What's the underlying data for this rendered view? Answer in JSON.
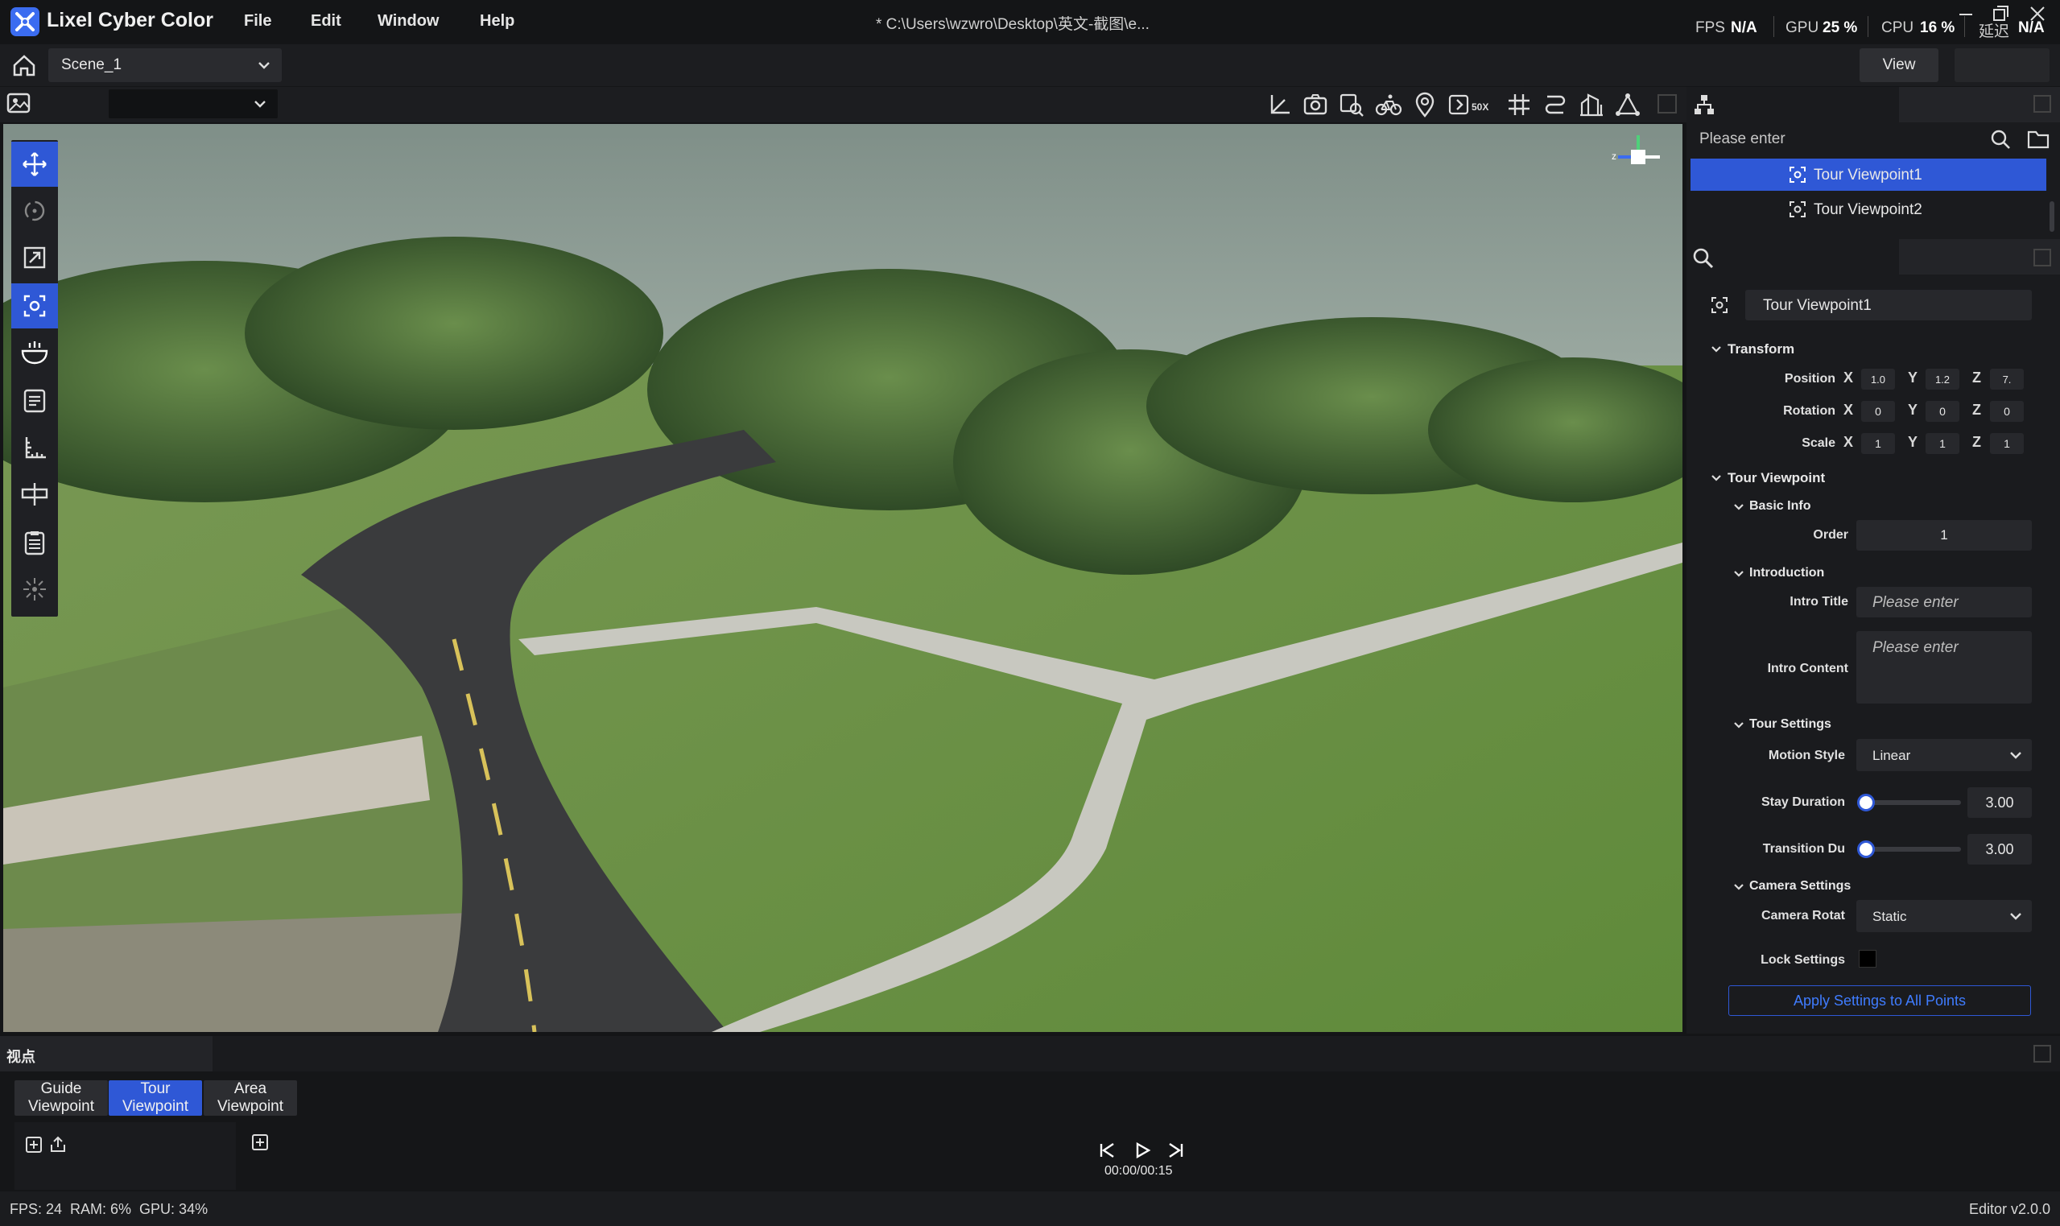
{
  "app": {
    "name": "Lixel Cyber Color",
    "menu": [
      "File",
      "Edit",
      "Window",
      "Help"
    ],
    "file_path": "* C:\\Users\\wzwro\\Desktop\\英文-截图\\e...",
    "stats": {
      "fps_label": "FPS",
      "fps_value": "N/A",
      "gpu_label": "GPU",
      "gpu_value": "25 %",
      "cpu_label": "CPU",
      "cpu_value": "16 %",
      "latency_label": "延迟",
      "latency_value": "N/A"
    }
  },
  "toolbar": {
    "scene": "Scene_1",
    "view_button": "View",
    "icons": [
      "coordinate-icon",
      "camera-icon",
      "search-viewpoint-icon",
      "bike-icon",
      "location-pin-icon",
      "speed-50x-icon",
      "grid-icon",
      "route-icon",
      "building-icon",
      "vertex-icon"
    ],
    "speed_label": "50X"
  },
  "left_tools": [
    "move-icon",
    "rotate-icon",
    "scale-icon",
    "viewpoint-icon",
    "bowl-icon",
    "notes-icon",
    "measure-icon",
    "signpost-icon",
    "clipboard-icon",
    "light-icon"
  ],
  "outline": {
    "search_placeholder": "Please enter",
    "items": [
      {
        "label": "Tour Viewpoint1",
        "selected": true
      },
      {
        "label": "Tour Viewpoint2",
        "selected": false
      }
    ]
  },
  "inspector": {
    "name": "Tour Viewpoint1",
    "transform": {
      "title": "Transform",
      "position_label": "Position",
      "rotation_label": "Rotation",
      "scale_label": "Scale",
      "axis_x": "X",
      "axis_y": "Y",
      "axis_z": "Z",
      "position": [
        "1.0",
        "1.2",
        "7."
      ],
      "rotation": [
        "0",
        "0",
        "0"
      ],
      "scale": [
        "1",
        "1",
        "1"
      ]
    },
    "tour_viewpoint": {
      "title": "Tour Viewpoint",
      "basic_info": "Basic Info",
      "order_label": "Order",
      "order_value": "1",
      "introduction": "Introduction",
      "intro_title_label": "Intro Title",
      "intro_title_placeholder": "Please enter",
      "intro_content_label": "Intro Content",
      "intro_content_placeholder": "Please enter",
      "tour_settings": "Tour Settings",
      "motion_style_label": "Motion Style",
      "motion_style_value": "Linear",
      "stay_duration_label": "Stay Duration",
      "stay_duration_value": "3.00",
      "stay_duration_level": 0.05,
      "transition_label": "Transition Du",
      "transition_value": "3.00",
      "transition_level": 0.05,
      "camera_settings": "Camera Settings",
      "camera_rotate_label": "Camera Rotat",
      "camera_rotate_value": "Static",
      "lock_settings_label": "Lock Settings",
      "apply_button": "Apply Settings to All Points"
    }
  },
  "bottom": {
    "panel_title": "视点",
    "tabs": [
      {
        "line1": "Guide",
        "line2": "Viewpoint",
        "active": false
      },
      {
        "line1": "Tour",
        "line2": "Viewpoint",
        "active": true
      },
      {
        "line1": "Area",
        "line2": "Viewpoint",
        "active": false
      }
    ],
    "time": "00:00/00:15"
  },
  "status": {
    "left": "FPS: 24  RAM: 6%  GPU: 34%",
    "right": "Editor v2.0.0"
  },
  "colors": {
    "accent": "#2f58d6",
    "background": "#141517"
  }
}
